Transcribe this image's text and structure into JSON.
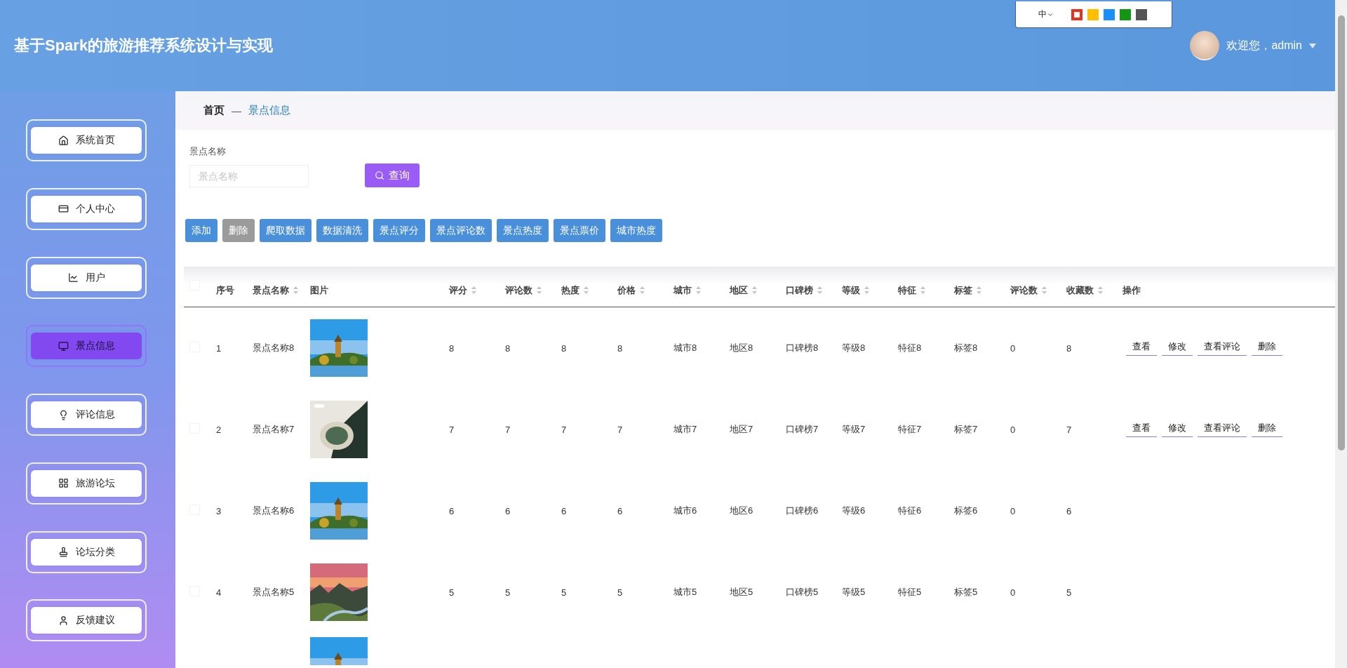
{
  "header": {
    "title": "基于Spark的旅游推荐系统设计与实现",
    "language": "中",
    "theme_colors": [
      {
        "color": "#e8321e",
        "selected": true
      },
      {
        "color": "#ffbf00",
        "selected": false
      },
      {
        "color": "#1890ff",
        "selected": false
      },
      {
        "color": "#159515",
        "selected": false
      },
      {
        "color": "#555555",
        "selected": false
      }
    ],
    "user": {
      "greeting": "欢迎您，admin"
    }
  },
  "sidebar": {
    "items": [
      {
        "label": "系统首页",
        "selected": false
      },
      {
        "label": "个人中心",
        "selected": false
      },
      {
        "label": "用户",
        "selected": false
      },
      {
        "label": "景点信息",
        "selected": true
      },
      {
        "label": "评论信息",
        "selected": false
      },
      {
        "label": "旅游论坛",
        "selected": false
      },
      {
        "label": "论坛分类",
        "selected": false
      },
      {
        "label": "反馈建议",
        "selected": false
      }
    ]
  },
  "breadcrumb": {
    "home": "首页",
    "separator": "—",
    "current": "景点信息"
  },
  "search": {
    "label": "景点名称",
    "placeholder": "景点名称",
    "button": "查询"
  },
  "toolbar": [
    {
      "label": "添加",
      "disabled": false
    },
    {
      "label": "删除",
      "disabled": true
    },
    {
      "label": "爬取数据",
      "disabled": false
    },
    {
      "label": "数据清洗",
      "disabled": false
    },
    {
      "label": "景点评分",
      "disabled": false
    },
    {
      "label": "景点评论数",
      "disabled": false
    },
    {
      "label": "景点热度",
      "disabled": false
    },
    {
      "label": "景点票价",
      "disabled": false
    },
    {
      "label": "城市热度",
      "disabled": false
    }
  ],
  "table": {
    "select_all": {
      "checked": false
    },
    "columns": [
      {
        "label": "序号",
        "sortable": false
      },
      {
        "label": "景点名称",
        "sortable": true
      },
      {
        "label": "图片",
        "sortable": false
      },
      {
        "label": "评分",
        "sortable": true
      },
      {
        "label": "评论数",
        "sortable": true
      },
      {
        "label": "热度",
        "sortable": true
      },
      {
        "label": "价格",
        "sortable": true
      },
      {
        "label": "城市",
        "sortable": true
      },
      {
        "label": "地区",
        "sortable": true
      },
      {
        "label": "口碑榜",
        "sortable": true
      },
      {
        "label": "等级",
        "sortable": true
      },
      {
        "label": "特征",
        "sortable": true
      },
      {
        "label": "标签",
        "sortable": true
      },
      {
        "label": "评论数",
        "sortable": true
      },
      {
        "label": "收藏数",
        "sortable": true
      },
      {
        "label": "操作",
        "sortable": false
      }
    ],
    "rows": [
      {
        "checked": false,
        "picture": {
          "kind": "picture"
        },
        "cells": [
          "1",
          "景点名称8",
          "",
          "8",
          "8",
          "8",
          "8",
          "城市8",
          "地区8",
          "口碑榜8",
          "等级8",
          "特征8",
          "标签8",
          "0",
          "8"
        ],
        "actions": [
          "查看",
          "修改",
          "查看评论",
          "删除"
        ]
      },
      {
        "checked": false,
        "picture": {
          "kind": "picture"
        },
        "cells": [
          "2",
          "景点名称7",
          "",
          "7",
          "7",
          "7",
          "7",
          "城市7",
          "地区7",
          "口碑榜7",
          "等级7",
          "特征7",
          "标签7",
          "0",
          "7"
        ],
        "actions": [
          "查看",
          "修改",
          "查看评论",
          "删除"
        ]
      },
      {
        "checked": false,
        "picture": {
          "kind": "picture"
        },
        "cells": [
          "3",
          "景点名称6",
          "",
          "6",
          "6",
          "6",
          "6",
          "城市6",
          "地区6",
          "口碑榜6",
          "等级6",
          "特征6",
          "标签6",
          "0",
          "6"
        ]
      },
      {
        "checked": false,
        "picture": {
          "kind": "picture"
        },
        "cells": [
          "4",
          "景点名称5",
          "",
          "5",
          "5",
          "5",
          "5",
          "城市5",
          "地区5",
          "口碑榜5",
          "等级5",
          "特征5",
          "标签5",
          "0",
          "5"
        ]
      }
    ],
    "partial_row": {
      "picture": {
        "kind": "picture"
      }
    }
  }
}
